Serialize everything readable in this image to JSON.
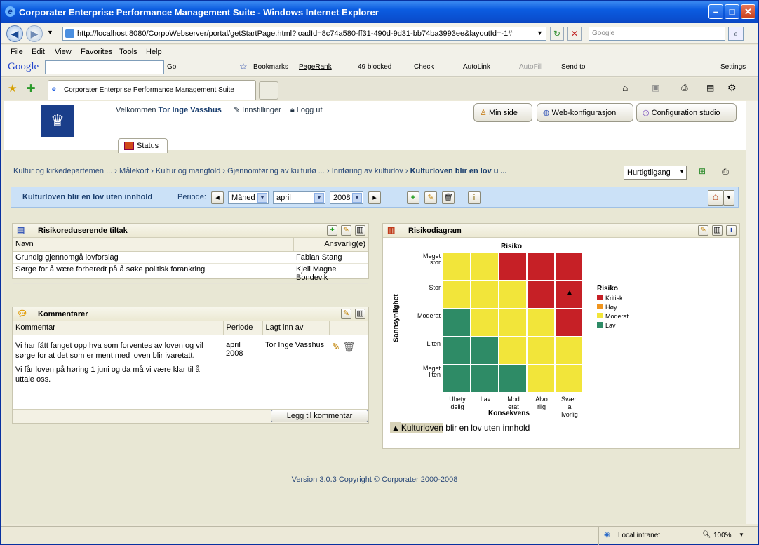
{
  "window": {
    "title": "Corporater Enterprise Performance Management Suite - Windows Internet Explorer"
  },
  "browser": {
    "url": "http://localhost:8080/CorpoWebserver/portal/getStartPage.html?loadId=8c74a580-ff31-490d-9d31-bb74ba3993ee&layoutId=-1#",
    "search_placeholder": "Google",
    "menu": [
      "File",
      "Edit",
      "View",
      "Favorites",
      "Tools",
      "Help"
    ],
    "google_toolbar": {
      "go": "Go",
      "bookmarks": "Bookmarks",
      "pagerank": "PageRank",
      "blocked": "49 blocked",
      "check": "Check",
      "autolink": "AutoLink",
      "autofill": "AutoFill",
      "sendto": "Send to",
      "settings": "Settings"
    },
    "tab_title": "Corporater Enterprise Performance Management Suite",
    "status_zone": "Local intranet",
    "zoom": "100%"
  },
  "app": {
    "welcome_prefix": "Velkommen",
    "user": "Tor Inge Vasshus",
    "settings_link": "Innstillinger",
    "logout_link": "Logg ut",
    "buttons": {
      "my_page": "Min side",
      "web_config": "Web-konfigurasjon",
      "config_studio": "Configuration studio"
    },
    "status_tab": "Status",
    "breadcrumb": [
      "Kultur og kirkedepartemen ...",
      "Målekort",
      "Kultur og mangfold",
      "Gjennomføring av kulturlø ...",
      "Innføring av kulturlov",
      "Kulturloven blir en lov u ..."
    ],
    "quick_access": "Hurtigtilgang",
    "page_title": "Kulturloven blir en lov uten innhold",
    "period_label": "Periode:",
    "period_type": "Måned",
    "month": "april",
    "year": "2008",
    "footer": "Version 3.0.3 Copyright © Corporater 2000-2008"
  },
  "risk_measures": {
    "title": "Risikoreduserende tiltak",
    "columns": [
      "Navn",
      "Ansvarlig(e)"
    ],
    "rows": [
      {
        "name": "Grundig gjennomgå lovforslag",
        "owner": "Fabian Stang"
      },
      {
        "name": "Sørge for å være forberedt på å søke politisk forankring",
        "owner": "Kjell Magne Bondevik"
      }
    ]
  },
  "comments": {
    "title": "Kommentarer",
    "columns": [
      "Kommentar",
      "Periode",
      "Lagt inn av"
    ],
    "rows": [
      {
        "text1": "Vi har fått fanget opp hva som forventes av loven og vil sørge for at det som er ment med loven blir ivaretatt.",
        "text2": "Vi får loven på høring 1 juni og da må vi være klar til å uttale oss.",
        "period": "april 2008",
        "author": "Tor Inge Vasshus"
      }
    ],
    "add_button": "Legg til kommentar"
  },
  "risk_diagram": {
    "title": "Risikodiagram",
    "chart_title": "Risiko",
    "y_axis_label": "Sannsynlighet",
    "x_axis_label": "Konsekvens",
    "y_levels": [
      "Meget stor",
      "Stor",
      "Moderat",
      "Liten",
      "Meget liten"
    ],
    "x_levels": [
      "Ubety delig",
      "Lav",
      "Mod erat",
      "Alvo rlig",
      "Svært a lvorlig"
    ],
    "legend_title": "Risiko",
    "legend": [
      {
        "label": "Kritisk",
        "color": "#c62026"
      },
      {
        "label": "Høy",
        "color": "#f0951e"
      },
      {
        "label": "Moderat",
        "color": "#f2e53a"
      },
      {
        "label": "Lav",
        "color": "#2e8b66"
      }
    ],
    "matrix": [
      [
        "Moderat",
        "Moderat",
        "Kritisk",
        "Kritisk",
        "Kritisk"
      ],
      [
        "Moderat",
        "Moderat",
        "Moderat",
        "Kritisk",
        "Kritisk"
      ],
      [
        "Lav",
        "Moderat",
        "Moderat",
        "Moderat",
        "Kritisk"
      ],
      [
        "Lav",
        "Lav",
        "Moderat",
        "Moderat",
        "Moderat"
      ],
      [
        "Lav",
        "Lav",
        "Lav",
        "Moderat",
        "Moderat"
      ]
    ],
    "marker": {
      "probability": "Stor",
      "consequence": "Svært a lvorlig",
      "label_highlight": "Kulturloven",
      "label_rest": " blir en lov uten innhold"
    }
  }
}
